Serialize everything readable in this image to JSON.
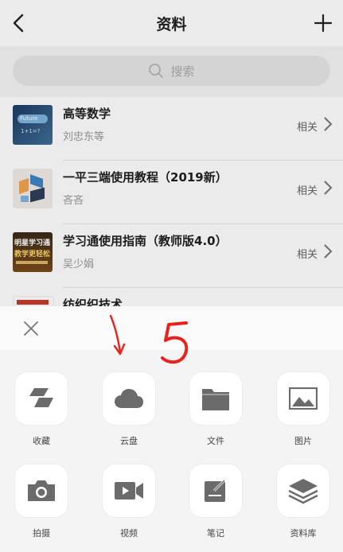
{
  "header": {
    "title": "资料"
  },
  "search": {
    "placeholder": "搜索"
  },
  "items": [
    {
      "title": "高等数学",
      "subtitle": "刘忠东等",
      "related": "相关",
      "cover_text": "Future",
      "cover_text2": "1+1=?"
    },
    {
      "title": "一平三端使用教程（2019新）",
      "subtitle": "吝吝",
      "related": "相关"
    },
    {
      "title": "学习通使用指南（教师版4.0）",
      "subtitle": "吴少娟",
      "related": "相关",
      "cover_text": "明星学习通",
      "cover_text2": "教学更轻松"
    },
    {
      "title": "纺织织技术",
      "subtitle": "",
      "related": ""
    }
  ],
  "sheet": {
    "options": [
      {
        "label": "收藏",
        "icon": "favorite-icon"
      },
      {
        "label": "云盘",
        "icon": "cloud-icon"
      },
      {
        "label": "文件",
        "icon": "folder-icon"
      },
      {
        "label": "图片",
        "icon": "image-icon"
      },
      {
        "label": "拍摄",
        "icon": "camera-icon"
      },
      {
        "label": "视频",
        "icon": "video-icon"
      },
      {
        "label": "笔记",
        "icon": "note-icon"
      },
      {
        "label": "资料库",
        "icon": "library-icon"
      }
    ]
  },
  "annotation": {
    "number": "5"
  },
  "colors": {
    "icon_gray": "#6b6b6b",
    "annotation_red": "#e8231d"
  }
}
